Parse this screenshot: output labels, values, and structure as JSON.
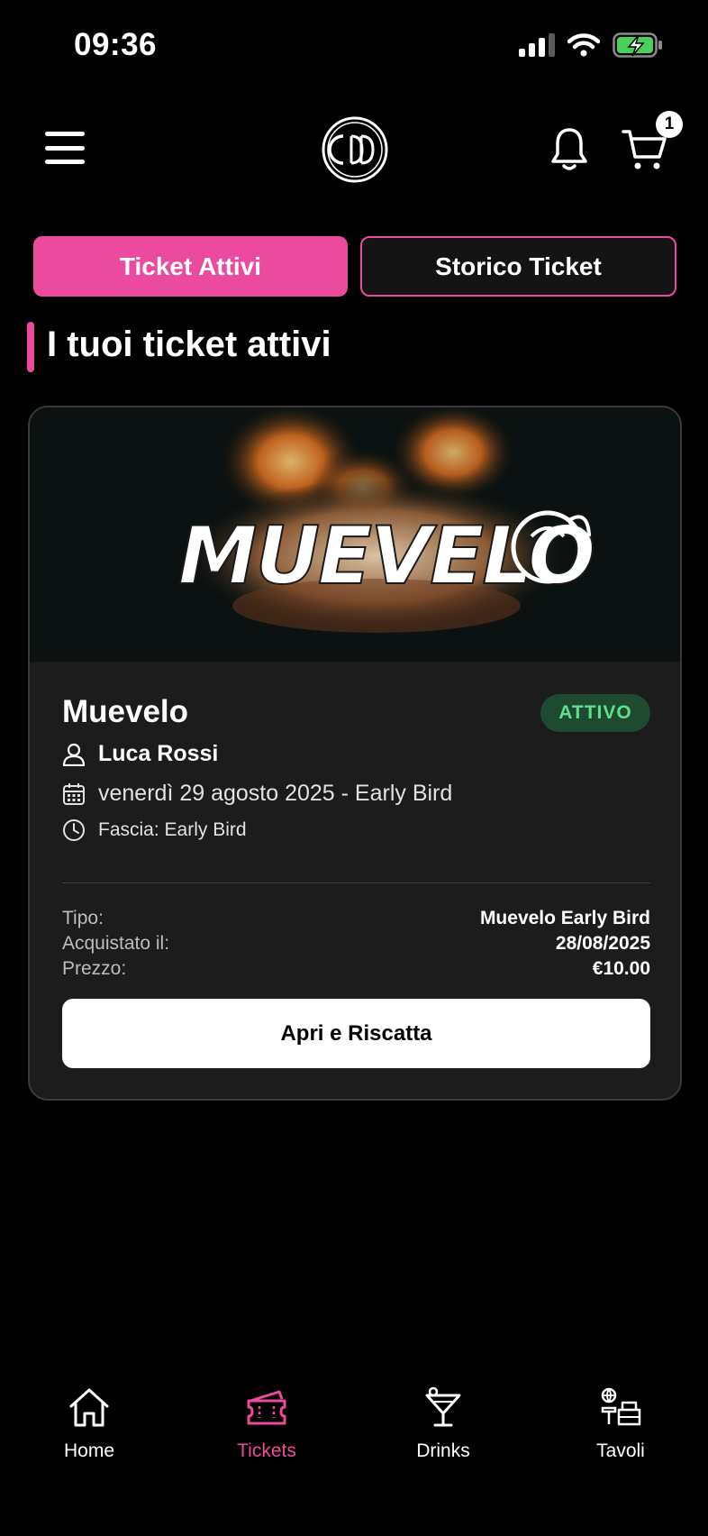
{
  "status_bar": {
    "time": "09:36"
  },
  "header": {
    "cart_count": "1"
  },
  "tabs": [
    {
      "label": "Ticket Attivi",
      "active": true
    },
    {
      "label": "Storico Ticket",
      "active": false
    }
  ],
  "section": {
    "title": "I tuoi ticket attivi"
  },
  "ticket": {
    "image_logo_text": "MUEVELO",
    "event_name": "Muevelo",
    "status": "ATTIVO",
    "holder": "Luca Rossi",
    "date_line": "venerdì 29 agosto 2025 - Early Bird",
    "band_line": "Fascia: Early Bird",
    "details": [
      {
        "label": "Tipo:",
        "value": "Muevelo Early Bird"
      },
      {
        "label": "Acquistato il:",
        "value": "28/08/2025"
      },
      {
        "label": "Prezzo:",
        "value": "€10.00"
      }
    ],
    "cta_label": "Apri e Riscatta"
  },
  "nav": [
    {
      "label": "Home",
      "icon": "home-icon",
      "active": false
    },
    {
      "label": "Tickets",
      "icon": "ticket-icon",
      "active": true
    },
    {
      "label": "Drinks",
      "icon": "cocktail-icon",
      "active": false
    },
    {
      "label": "Tavoli",
      "icon": "table-icon",
      "active": false
    }
  ],
  "colors": {
    "accent": "#eb4a9e",
    "background": "#000000",
    "card": "#1c1c1c",
    "badge_bg": "#1d4a30",
    "badge_text": "#5ee08a"
  }
}
